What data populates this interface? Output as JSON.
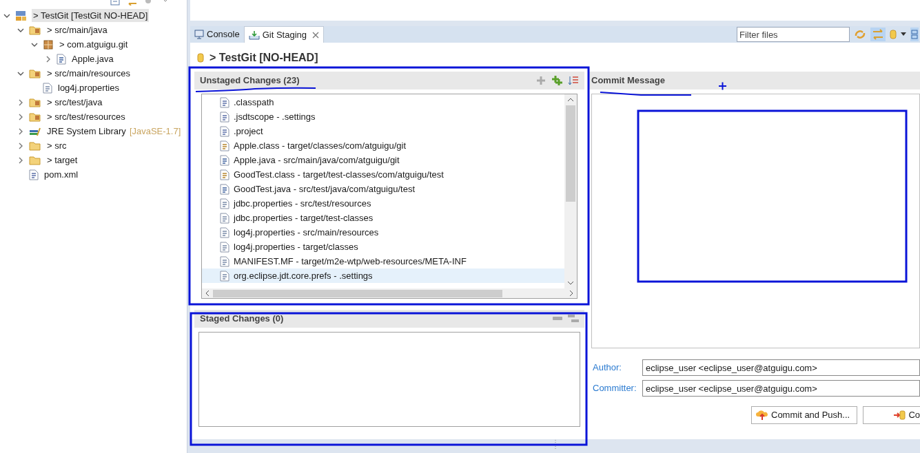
{
  "explorer": {
    "items": [
      {
        "label": "> TestGit [TestGit NO-HEAD]",
        "kind": "project",
        "expanded": true,
        "selected": true,
        "children": [
          {
            "label": "> src/main/java",
            "kind": "source-folder",
            "expanded": true,
            "selected": false,
            "children": [
              {
                "label": "> com.atguigu.git",
                "kind": "package",
                "expanded": true,
                "selected": false,
                "children": [
                  {
                    "label": "Apple.java",
                    "kind": "java-file",
                    "expanded": false,
                    "selected": false
                  }
                ]
              }
            ]
          },
          {
            "label": "> src/main/resources",
            "kind": "source-folder",
            "expanded": true,
            "selected": false,
            "children": [
              {
                "label": "log4j.properties",
                "kind": "file",
                "selected": false
              }
            ]
          },
          {
            "label": "> src/test/java",
            "kind": "source-folder",
            "expanded": false,
            "selected": false
          },
          {
            "label": "> src/test/resources",
            "kind": "source-folder",
            "expanded": false,
            "selected": false
          },
          {
            "label": "JRE System Library",
            "decoration": "[JavaSE-1.7]",
            "kind": "library",
            "expanded": false,
            "selected": false
          },
          {
            "label": "> src",
            "kind": "folder",
            "expanded": false,
            "selected": false
          },
          {
            "label": "> target",
            "kind": "folder",
            "expanded": false,
            "selected": false
          },
          {
            "label": "pom.xml",
            "kind": "xml-file",
            "selected": false
          }
        ]
      }
    ]
  },
  "tabs": [
    {
      "label": "Console",
      "kind": "console",
      "selected": false
    },
    {
      "label": "Git Staging",
      "kind": "staging",
      "selected": true
    }
  ],
  "filter": {
    "placeholder": "Filter files"
  },
  "repository_title": "> TestGit [NO-HEAD]",
  "unstaged": {
    "title": "Unstaged Changes (23)",
    "files": [
      {
        "label": ".classpath",
        "kind": "xml",
        "selected": false
      },
      {
        "label": ".jsdtscope - .settings",
        "kind": "xml",
        "selected": false
      },
      {
        "label": ".project",
        "kind": "xml",
        "selected": false
      },
      {
        "label": "Apple.class - target/classes/com/atguigu/git",
        "kind": "class",
        "selected": false
      },
      {
        "label": "Apple.java - src/main/java/com/atguigu/git",
        "kind": "java",
        "selected": false
      },
      {
        "label": "GoodTest.class - target/test-classes/com/atguigu/test",
        "kind": "class",
        "selected": false
      },
      {
        "label": "GoodTest.java - src/test/java/com/atguigu/test",
        "kind": "java",
        "selected": false
      },
      {
        "label": "jdbc.properties - src/test/resources",
        "kind": "text",
        "selected": false
      },
      {
        "label": "jdbc.properties - target/test-classes",
        "kind": "text",
        "selected": false
      },
      {
        "label": "log4j.properties - src/main/resources",
        "kind": "text",
        "selected": false
      },
      {
        "label": "log4j.properties - target/classes",
        "kind": "text",
        "selected": false
      },
      {
        "label": "MANIFEST.MF - target/m2e-wtp/web-resources/META-INF",
        "kind": "text",
        "selected": false
      },
      {
        "label": "org.eclipse.jdt.core.prefs - .settings",
        "kind": "text",
        "selected": true
      }
    ]
  },
  "staged": {
    "title": "Staged Changes (0)"
  },
  "commit": {
    "title": "Commit Message",
    "author_label": "Author:",
    "author": "eclipse_user <eclipse_user@atguigu.com>",
    "committer_label": "Committer:",
    "committer": "eclipse_user <eclipse_user@atguigu.com>",
    "buttons": [
      {
        "label": "Commit and Push...",
        "kind": "push"
      },
      {
        "label": "Co",
        "kind": "commit"
      }
    ]
  }
}
